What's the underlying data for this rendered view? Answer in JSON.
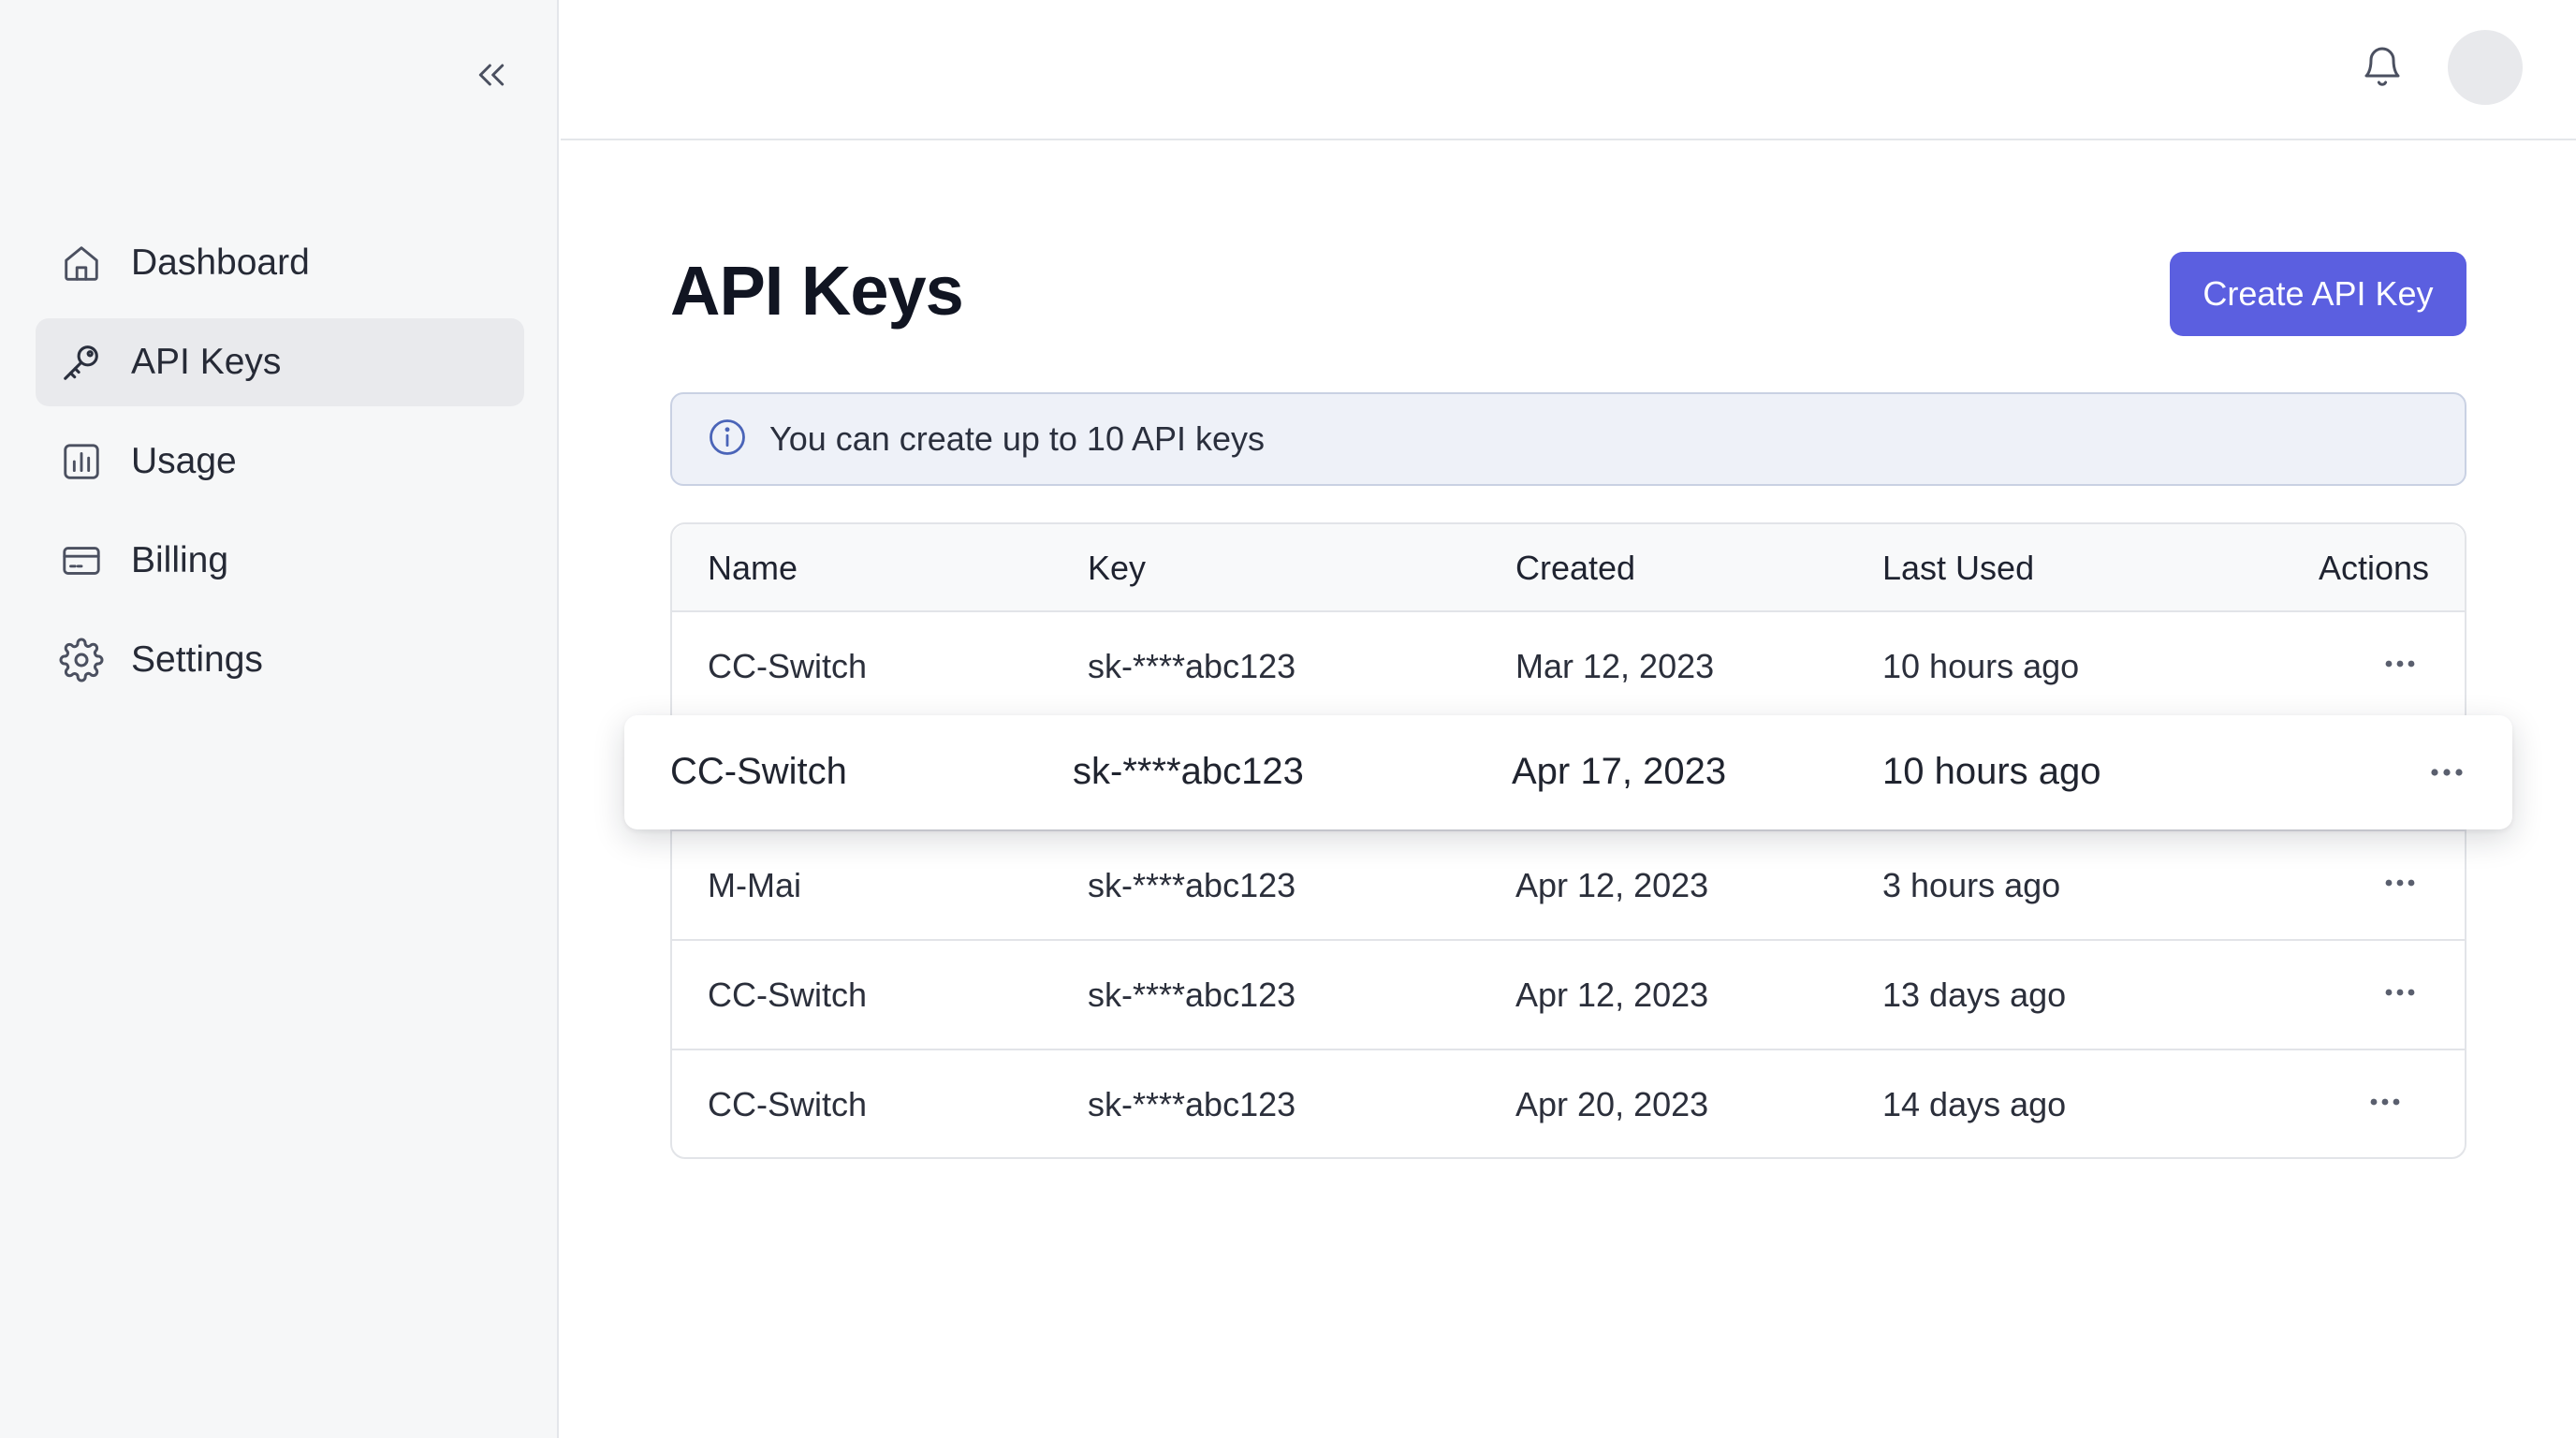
{
  "sidebar": {
    "items": [
      {
        "label": "Dashboard",
        "icon": "home-icon"
      },
      {
        "label": "API Keys",
        "icon": "key-icon",
        "active": true
      },
      {
        "label": "Usage",
        "icon": "bar-chart-icon"
      },
      {
        "label": "Billing",
        "icon": "credit-card-icon"
      },
      {
        "label": "Settings",
        "icon": "gear-icon"
      }
    ]
  },
  "main": {
    "title": "API Keys",
    "create_button": "Create API Key",
    "info": "You can create up to 10 API keys"
  },
  "table": {
    "headers": {
      "name": "Name",
      "key": "Key",
      "created": "Created",
      "last_used": "Last Used",
      "actions": "Actions"
    },
    "rows": [
      {
        "name": "CC-Switch",
        "key": "sk-****abc123",
        "created": "Mar 12, 2023",
        "last_used": "10 hours ago"
      },
      {
        "name": "CC-Switch",
        "key": "sk-****abc123",
        "created": "Apr 17, 2023",
        "last_used": "10 hours ago",
        "dragging": true
      },
      {
        "name": "M-Mai",
        "key": "sk-****abc123",
        "created": "Apr 12, 2023",
        "last_used": "3 hours ago"
      },
      {
        "name": "CC-Switch",
        "key": "sk-****abc123",
        "created": "Apr 12, 2023",
        "last_used": "13 days ago"
      },
      {
        "name": "CC-Switch",
        "key": "sk-****abc123",
        "created": "Apr 20, 2023",
        "last_used": "14 days ago"
      }
    ]
  },
  "colors": {
    "accent": "#5b5fe0",
    "sidebar_bg": "#f6f7f8",
    "active_item_bg": "#e9eaed",
    "info_bg": "#eef1f8",
    "info_border": "#c9d1e3",
    "info_icon": "#4a64b8"
  }
}
